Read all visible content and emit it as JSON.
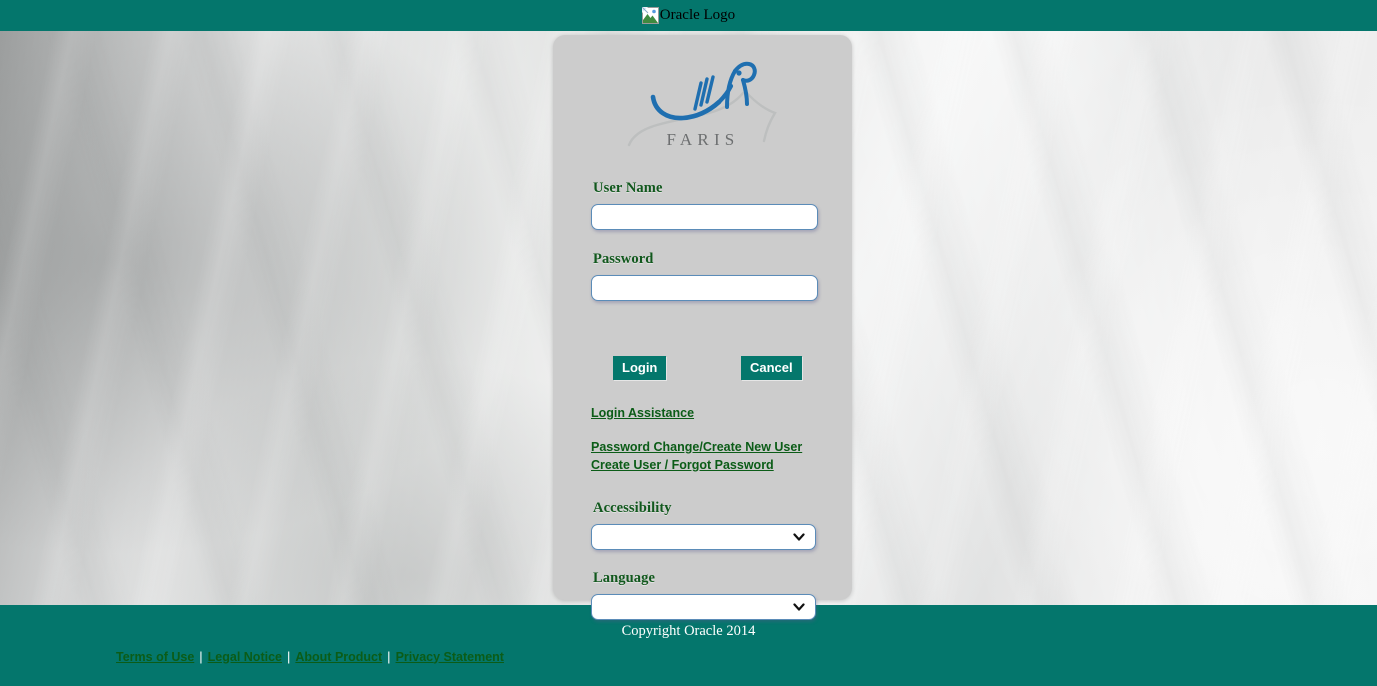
{
  "header": {
    "logo_alt": "Oracle Logo",
    "logo_icon": "broken-image-icon",
    "background_color": "#04766c"
  },
  "brand": {
    "wordmark": "FARIS",
    "calligraphy_color": "#1f6fb0",
    "wordmark_color": "#6d6f70"
  },
  "login_form": {
    "username": {
      "label": "User Name",
      "value": "",
      "placeholder": ""
    },
    "password": {
      "label": "Password",
      "value": "",
      "placeholder": ""
    },
    "buttons": {
      "login": "Login",
      "cancel": "Cancel"
    },
    "links": [
      {
        "label": "Login Assistance"
      },
      {
        "label": "Password Change/Create New User"
      },
      {
        "label": "Create User / Forgot Password"
      }
    ],
    "accessibility": {
      "label": "Accessibility",
      "selected": "",
      "options": [
        ""
      ]
    },
    "language": {
      "label": "Language",
      "selected": "",
      "options": [
        ""
      ]
    }
  },
  "footer": {
    "copyright": "Copyright Oracle 2014",
    "links": [
      {
        "label": "Terms of Use"
      },
      {
        "label": "Legal Notice"
      },
      {
        "label": "About Product"
      },
      {
        "label": "Privacy Statement"
      }
    ],
    "separator": "|",
    "background_color": "#04766c",
    "link_color": "#0b5c17"
  },
  "theme": {
    "teal": "#04766c",
    "panel_gray": "#cccccc",
    "label_green": "#11581d",
    "input_border_blue": "#5b8cb8"
  }
}
